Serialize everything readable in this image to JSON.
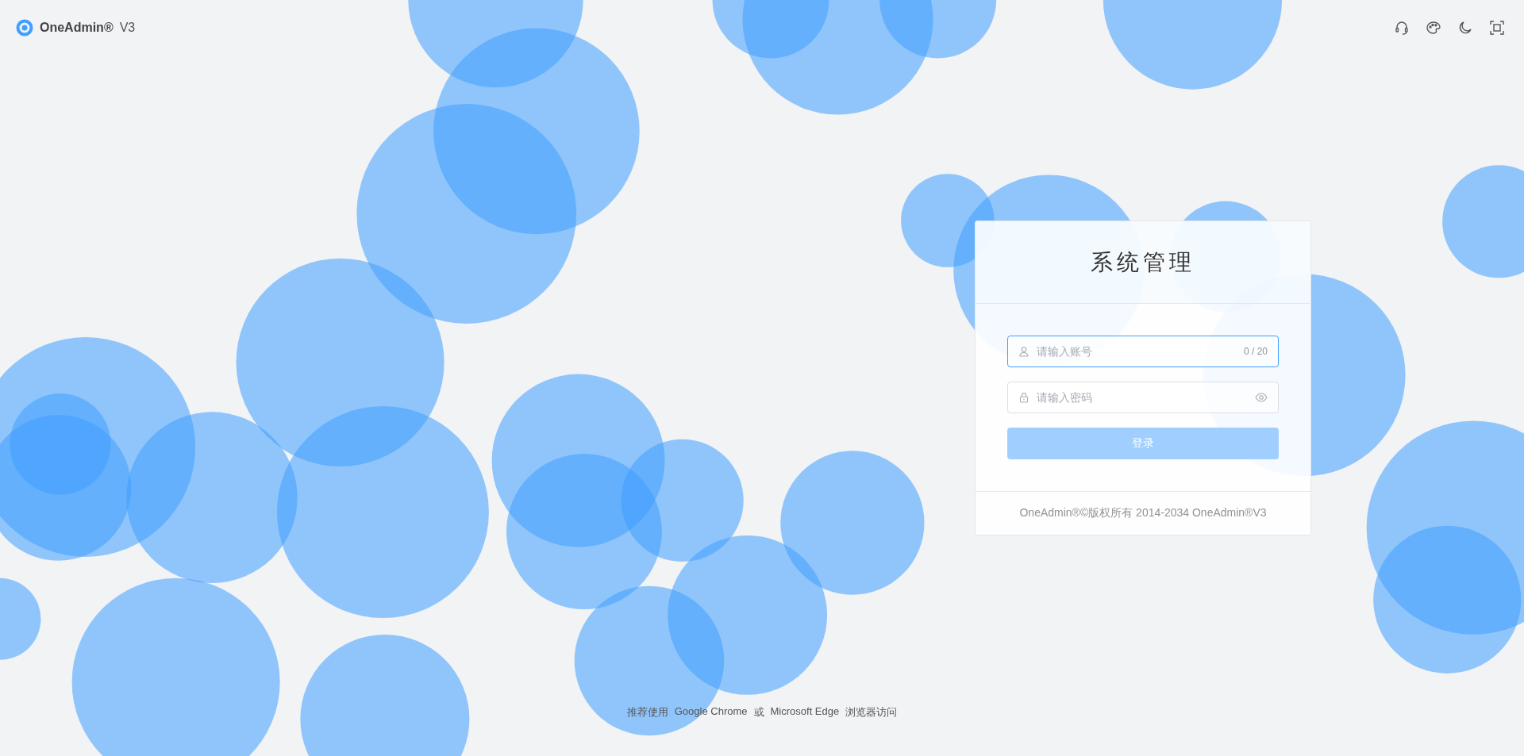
{
  "brand": {
    "name": "OneAdmin®",
    "version": "V3"
  },
  "login": {
    "title": "系统管理",
    "username": {
      "placeholder": "请输入账号",
      "counter": "0 / 20",
      "focused": true
    },
    "password": {
      "placeholder": "请输入密码",
      "focused": false
    },
    "submit": {
      "label": "登录",
      "disabled": true
    },
    "footer": "OneAdmin®©版权所有 2014-2034 OneAdmin®V3"
  },
  "browser_hint": [
    "推荐使用",
    "Google Chrome",
    "或",
    "Microsoft Edge",
    "浏览器访问"
  ]
}
